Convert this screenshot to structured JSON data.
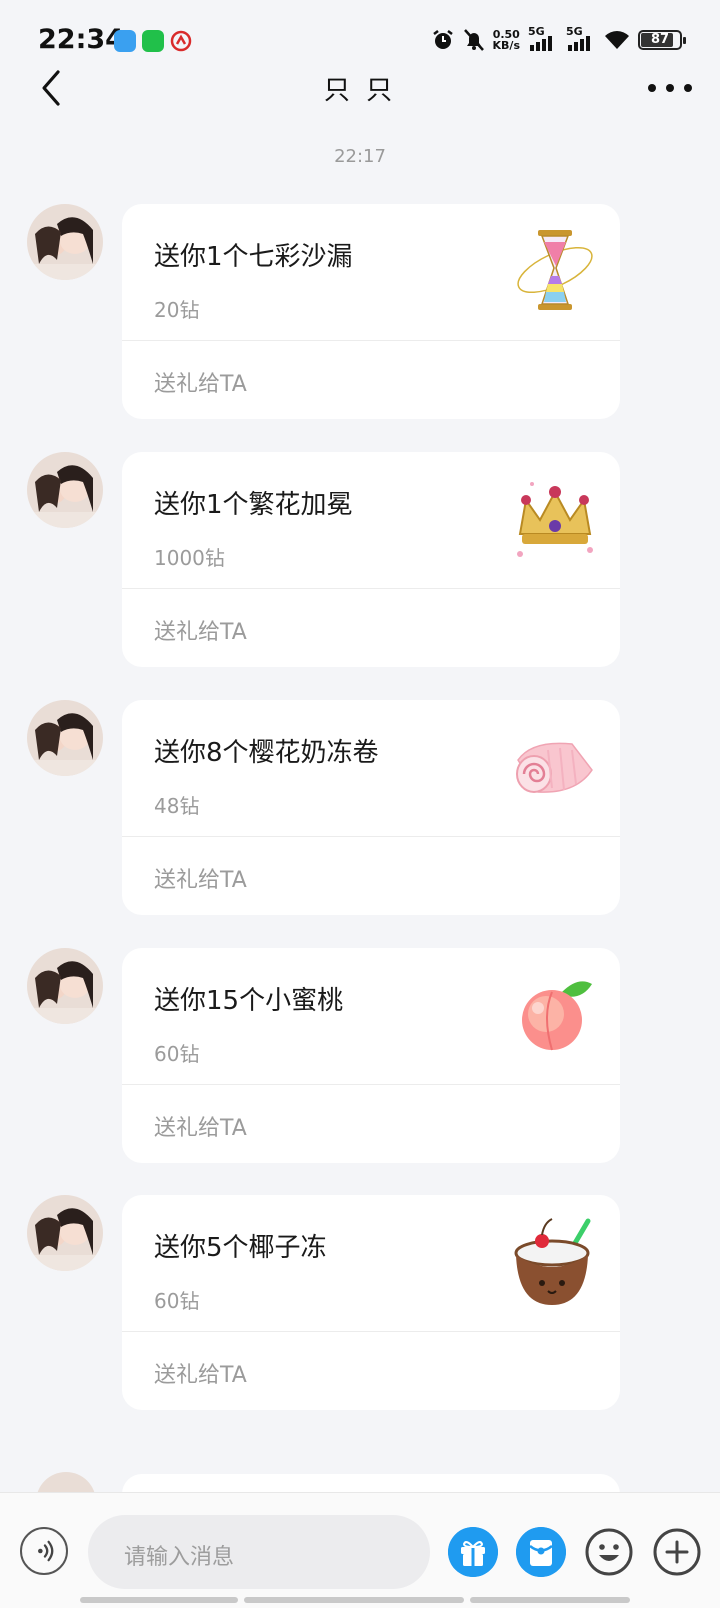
{
  "status_bar": {
    "time": "22:34",
    "net_speed_value": "0.50",
    "net_speed_unit": "KB/s",
    "sim1_label": "5G",
    "sim2_label": "5G",
    "battery": "87",
    "app_icons": [
      "blue-app-icon",
      "wechat-icon",
      "red-app-icon"
    ]
  },
  "header": {
    "title": "只 只"
  },
  "conversation": {
    "timestamp": "22:17",
    "messages": [
      {
        "title": "送你1个七彩沙漏",
        "price": "20钻",
        "action": "送礼给TA",
        "gift_icon": "rainbow-hourglass-icon"
      },
      {
        "title": "送你1个繁花加冕",
        "price": "1000钻",
        "action": "送礼给TA",
        "gift_icon": "crown-icon"
      },
      {
        "title": "送你8个樱花奶冻卷",
        "price": "48钻",
        "action": "送礼给TA",
        "gift_icon": "sakura-roll-cake-icon"
      },
      {
        "title": "送你15个小蜜桃",
        "price": "60钻",
        "action": "送礼给TA",
        "gift_icon": "peach-icon"
      },
      {
        "title": "送你5个椰子冻",
        "price": "60钻",
        "action": "送礼给TA",
        "gift_icon": "coconut-jelly-icon"
      }
    ]
  },
  "input_bar": {
    "placeholder": "请输入消息"
  },
  "colors": {
    "background": "#f4f5f8",
    "card": "#ffffff",
    "accent_blue": "#1f9bf0",
    "muted_text": "#9b9b9b"
  }
}
